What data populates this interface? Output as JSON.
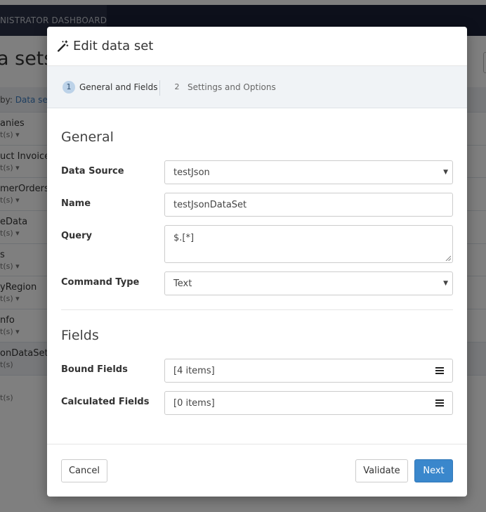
{
  "background": {
    "nav_label": "NISTRATOR DASHBOARD",
    "page_title": "a sets",
    "groupby_prefix": "by:",
    "groupby_value": "Data set",
    "items": [
      {
        "name": "anies",
        "sub": "t(s) ▾"
      },
      {
        "name": "uct Invoice",
        "sub": "t(s) ▾"
      },
      {
        "name": "merOrders",
        "sub": "t(s) ▾"
      },
      {
        "name": "eData",
        "sub": "t(s) ▾"
      },
      {
        "name": "s",
        "sub": "t(s) ▾"
      },
      {
        "name": "yRegion",
        "sub": "t(s) ▾"
      },
      {
        "name": "nfo",
        "sub": "t(s) ▾"
      },
      {
        "name": "onDataSet",
        "sub": "t(s)"
      },
      {
        "name": "",
        "sub": "t(s)"
      }
    ]
  },
  "modal": {
    "title": "Edit data set",
    "title_icon": "magic-wand-icon",
    "steps": [
      {
        "number": "1",
        "label": "General and Fields",
        "active": true
      },
      {
        "number": "2",
        "label": "Settings and Options",
        "active": false
      }
    ],
    "general": {
      "heading": "General",
      "data_source_label": "Data Source",
      "data_source_value": "testJson",
      "name_label": "Name",
      "name_value": "testJsonDataSet",
      "query_label": "Query",
      "query_value": "$.[*]",
      "command_type_label": "Command Type",
      "command_type_value": "Text"
    },
    "fields": {
      "heading": "Fields",
      "bound_fields_label": "Bound Fields",
      "bound_fields_value": "[4 items]",
      "calculated_fields_label": "Calculated Fields",
      "calculated_fields_value": "[0 items]"
    },
    "footer": {
      "cancel_label": "Cancel",
      "validate_label": "Validate",
      "next_label": "Next"
    }
  },
  "colors": {
    "navbar": "#1b2136",
    "primary": "#3a87cc",
    "step_badge": "#bcd2e8"
  }
}
